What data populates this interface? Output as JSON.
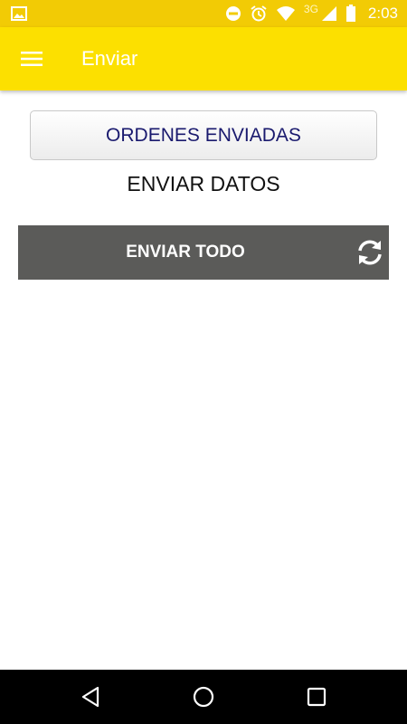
{
  "status_bar": {
    "network_type": "3G",
    "time": "2:03",
    "icons": [
      "image-notification-icon",
      "do-not-disturb-icon",
      "alarm-icon",
      "wifi-icon",
      "signal-icon",
      "battery-icon"
    ]
  },
  "app_bar": {
    "title": "Enviar",
    "menu_icon": "hamburger-menu-icon"
  },
  "main": {
    "orders_button_label": "ORDENES ENVIADAS",
    "section_title": "ENVIAR DATOS",
    "send_all_label": "ENVIAR TODO",
    "send_all_icon": "sync-icon"
  },
  "nav_bar": {
    "icons": [
      "back-icon",
      "home-icon",
      "recents-icon"
    ]
  },
  "colors": {
    "status_bar": "#f2cb05",
    "app_bar": "#fce000",
    "send_all_bar": "#5b5b59",
    "orders_text": "#1a1a6e"
  }
}
